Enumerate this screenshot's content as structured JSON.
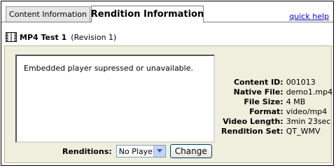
{
  "tabs": [
    {
      "label": "Content Information"
    },
    {
      "label": "Rendition Information"
    }
  ],
  "help_link": "quick help",
  "title": {
    "name": "MP4 Test 1",
    "revision": "(Revision 1)"
  },
  "player_message": "Embedded player supressed or unavailable.",
  "info": [
    {
      "label": "Content ID:",
      "value": "001013"
    },
    {
      "label": "Native File:",
      "value": "demo1.mp4"
    },
    {
      "label": "File Size:",
      "value": "4 MB"
    },
    {
      "label": "Format:",
      "value": "video/mp4"
    },
    {
      "label": "Video Length:",
      "value": "3min 23sec"
    },
    {
      "label": "Rendition Set:",
      "value": "QT_WMV"
    }
  ],
  "renditions": {
    "label": "Renditions:",
    "selected": "No Player",
    "button": "Change"
  }
}
